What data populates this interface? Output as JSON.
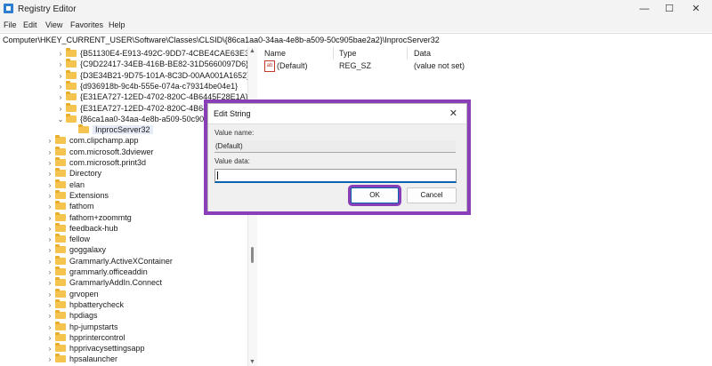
{
  "window": {
    "title": "Registry Editor",
    "minimize": "—",
    "maximize": "☐",
    "close": "✕",
    "icon": "registry-editor-icon"
  },
  "menu": [
    "File",
    "Edit",
    "View",
    "Favorites",
    "Help"
  ],
  "address": "Computer\\HKEY_CURRENT_USER\\Software\\Classes\\CLSID\\{86ca1aa0-34aa-4e8b-a509-50c905bae2a2}\\InprocServer32",
  "tree": [
    {
      "label": "{B51130E4-E913-492C-9DD7-4CBE4CAE63E3}",
      "level": 2,
      "expander": "›"
    },
    {
      "label": "{C9D22417-34EB-416B-BE82-31D5660097D6}",
      "level": 2,
      "expander": "›"
    },
    {
      "label": "{D3E34B21-9D75-101A-8C3D-00AA001A1652}",
      "level": 2,
      "expander": "›"
    },
    {
      "label": "{d936918b-9c4b-555e-074a-c79314be04e1}",
      "level": 2,
      "expander": "›"
    },
    {
      "label": "{E31EA727-12ED-4702-820C-4B6445F28E1A}",
      "level": 2,
      "expander": "›"
    },
    {
      "label": "{E31EA727-12ED-4702-820C-4B6445F2",
      "level": 2,
      "expander": "›"
    },
    {
      "label": "{86ca1aa0-34aa-4e8b-a509-50c905bae",
      "level": 2,
      "expander": "⌄"
    },
    {
      "label": "InprocServer32",
      "level": 3,
      "expander": "",
      "selected": true
    },
    {
      "label": "com.clipchamp.app",
      "level": 1,
      "expander": "›"
    },
    {
      "label": "com.microsoft.3dviewer",
      "level": 1,
      "expander": "›"
    },
    {
      "label": "com.microsoft.print3d",
      "level": 1,
      "expander": "›"
    },
    {
      "label": "Directory",
      "level": 1,
      "expander": "›"
    },
    {
      "label": "elan",
      "level": 1,
      "expander": "›"
    },
    {
      "label": "Extensions",
      "level": 1,
      "expander": "›"
    },
    {
      "label": "fathom",
      "level": 1,
      "expander": "›"
    },
    {
      "label": "fathom+zoommtg",
      "level": 1,
      "expander": "›"
    },
    {
      "label": "feedback-hub",
      "level": 1,
      "expander": "›"
    },
    {
      "label": "fellow",
      "level": 1,
      "expander": "›"
    },
    {
      "label": "goggalaxy",
      "level": 1,
      "expander": "›"
    },
    {
      "label": "Grammarly.ActiveXContainer",
      "level": 1,
      "expander": "›"
    },
    {
      "label": "grammarly.officeaddin",
      "level": 1,
      "expander": "›"
    },
    {
      "label": "GrammarlyAddIn.Connect",
      "level": 1,
      "expander": "›"
    },
    {
      "label": "grvopen",
      "level": 1,
      "expander": "›"
    },
    {
      "label": "hpbatterycheck",
      "level": 1,
      "expander": "›"
    },
    {
      "label": "hpdiags",
      "level": 1,
      "expander": "›"
    },
    {
      "label": "hp-jumpstarts",
      "level": 1,
      "expander": "›"
    },
    {
      "label": "hpprintercontrol",
      "level": 1,
      "expander": "›"
    },
    {
      "label": "hpprivacysettingsapp",
      "level": 1,
      "expander": "›"
    },
    {
      "label": "hpsalauncher",
      "level": 1,
      "expander": "›"
    }
  ],
  "values_table": {
    "headers": {
      "name": "Name",
      "type": "Type",
      "data": "Data"
    },
    "rows": [
      {
        "name": "(Default)",
        "type": "REG_SZ",
        "data": "(value not set)",
        "icon": "string-value-icon",
        "icon_text": "ab"
      }
    ]
  },
  "dialog": {
    "title": "Edit String",
    "close": "✕",
    "value_name_label": "Value name:",
    "value_name": "(Default)",
    "value_data_label": "Value data:",
    "value_data": "",
    "ok_label": "OK",
    "cancel_label": "Cancel",
    "highlight_color": "#8a3fb8"
  }
}
